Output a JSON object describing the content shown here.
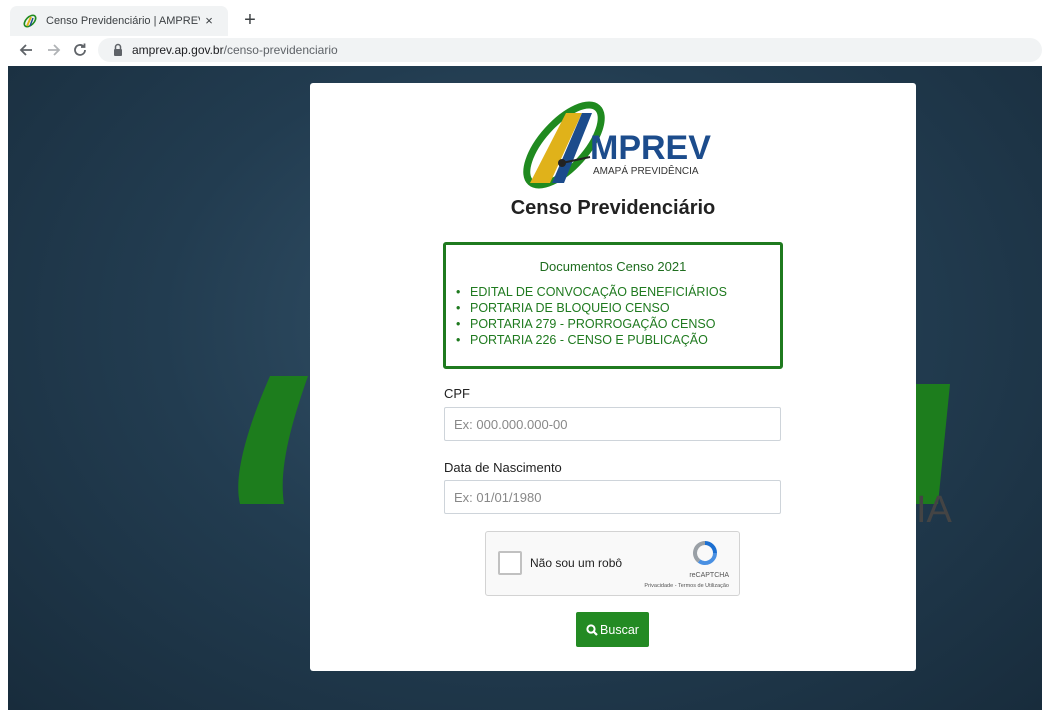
{
  "browser": {
    "tab_title": "Censo Previdenciário | AMPREV",
    "tab_close": "×",
    "new_tab": "+",
    "url_domain": "amprev.ap.gov.br",
    "url_path": "/censo-previdenciario"
  },
  "logo": {
    "brand": "MPREV",
    "subtitle": "AMAPÁ PREVIDÊNCIA",
    "colors": {
      "green": "#1f8a1f",
      "yellow": "#e0b21a",
      "blue": "#1c4c8c"
    }
  },
  "background": {
    "watermark_fragment": "IA"
  },
  "page": {
    "title": "Censo Previdenciário"
  },
  "documents": {
    "title": "Documentos Censo 2021",
    "items": [
      {
        "label": "EDITAL DE CONVOCAÇÃO BENEFICIÁRIOS"
      },
      {
        "label": "PORTARIA DE BLOQUEIO CENSO"
      },
      {
        "label": "PORTARIA 279 - PRORROGAÇÃO CENSO"
      },
      {
        "label": "PORTARIA 226 - CENSO E PUBLICAÇÃO"
      }
    ]
  },
  "form": {
    "cpf_label": "CPF",
    "cpf_placeholder": "Ex: 000.000.000-00",
    "birth_label": "Data de Nascimento",
    "birth_placeholder": "Ex: 01/01/1980",
    "submit_label": "Buscar"
  },
  "recaptcha": {
    "label": "Não sou um robô",
    "brand": "reCAPTCHA",
    "links": "Privacidade - Termos de Utilização"
  },
  "colors": {
    "accent_green": "#238a23",
    "docs_border": "#1f7a1f",
    "background": "#223c50"
  }
}
